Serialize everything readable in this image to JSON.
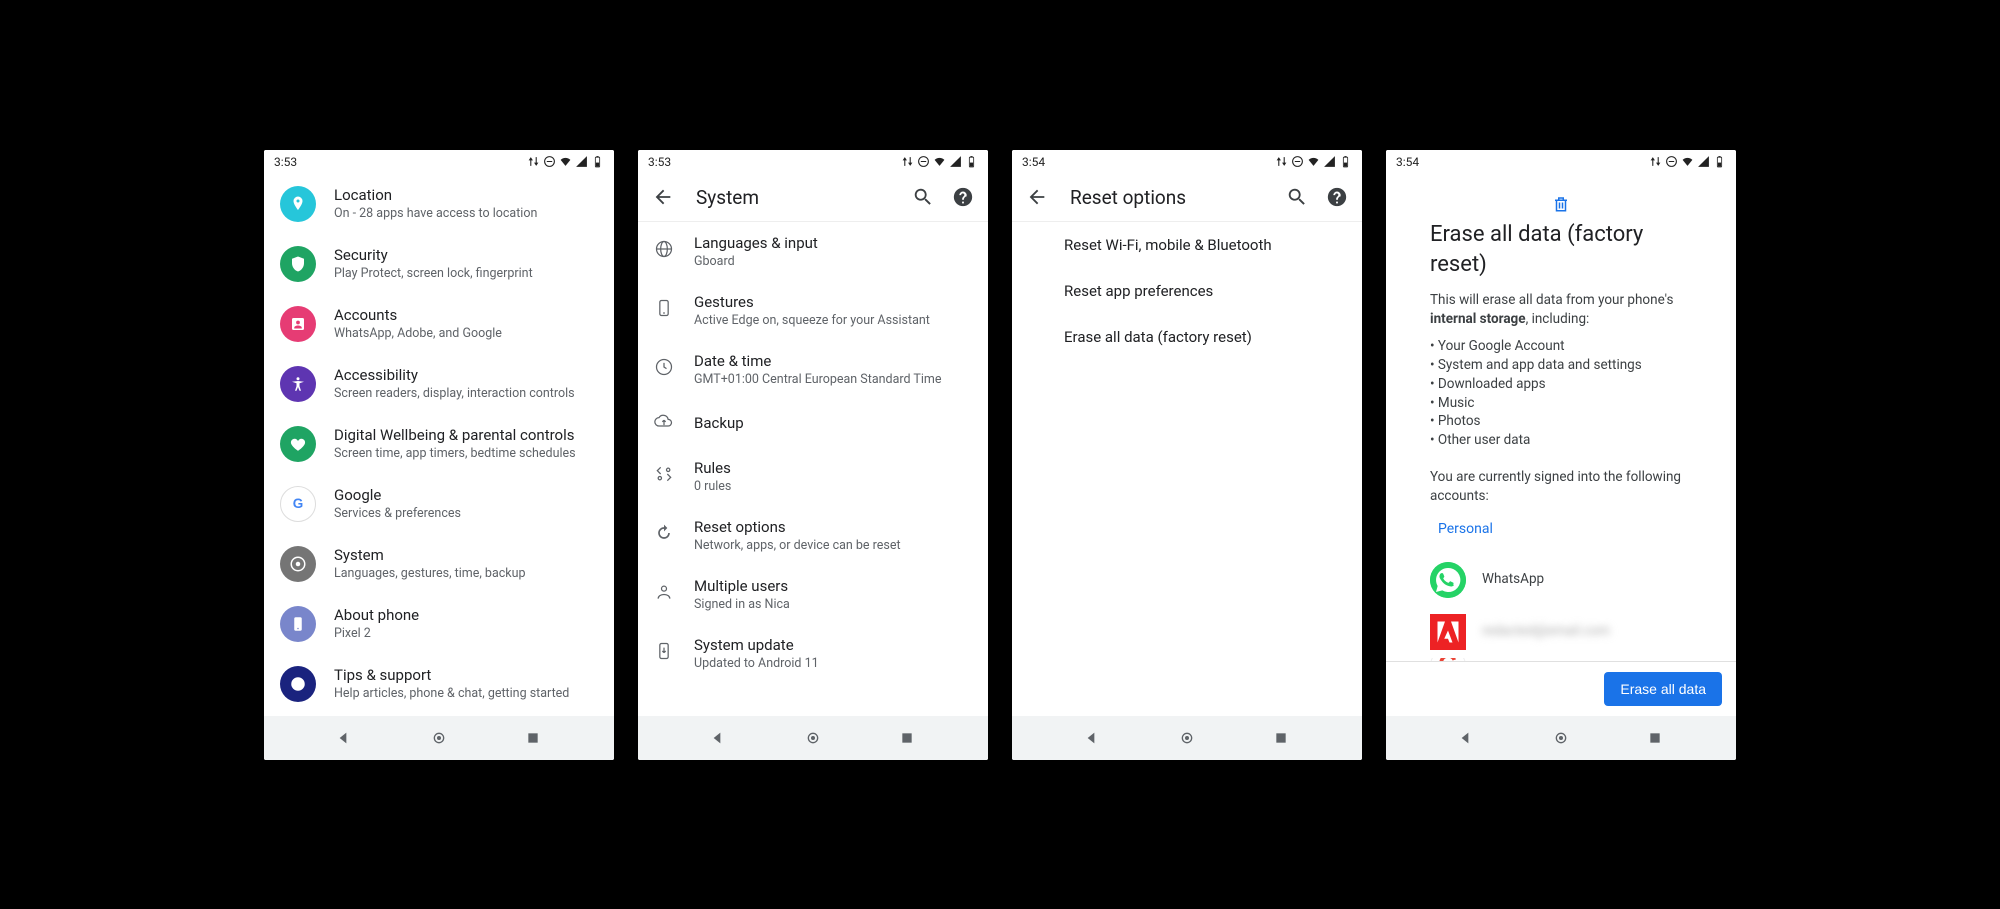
{
  "status": {
    "time1": "3:53",
    "time2": "3:53",
    "time3": "3:54",
    "time4": "3:54"
  },
  "screen1": {
    "items": [
      {
        "name": "location",
        "title": "Location",
        "sub": "On - 28 apps have access to location",
        "bg": "#26c6da"
      },
      {
        "name": "security",
        "title": "Security",
        "sub": "Play Protect, screen lock, fingerprint",
        "bg": "#1fa463"
      },
      {
        "name": "accounts",
        "title": "Accounts",
        "sub": "WhatsApp, Adobe, and Google",
        "bg": "#e63c74"
      },
      {
        "name": "accessibility",
        "title": "Accessibility",
        "sub": "Screen readers, display, interaction controls",
        "bg": "#5e35b1"
      },
      {
        "name": "wellbeing",
        "title": "Digital Wellbeing & parental controls",
        "sub": "Screen time, app timers, bedtime schedules",
        "bg": "#1fa463"
      },
      {
        "name": "google",
        "title": "Google",
        "sub": "Services & preferences",
        "bg": "#ffffff"
      },
      {
        "name": "system",
        "title": "System",
        "sub": "Languages, gestures, time, backup",
        "bg": "#757575"
      },
      {
        "name": "about",
        "title": "About phone",
        "sub": "Pixel 2",
        "bg": "#7986cb"
      },
      {
        "name": "tips",
        "title": "Tips & support",
        "sub": "Help articles, phone & chat, getting started",
        "bg": "#1a237e"
      }
    ]
  },
  "screen2": {
    "title": "System",
    "items": [
      {
        "name": "languages",
        "title": "Languages & input",
        "sub": "Gboard"
      },
      {
        "name": "gestures",
        "title": "Gestures",
        "sub": "Active Edge on, squeeze for your Assistant"
      },
      {
        "name": "datetime",
        "title": "Date & time",
        "sub": "GMT+01:00 Central European Standard Time"
      },
      {
        "name": "backup",
        "title": "Backup",
        "sub": ""
      },
      {
        "name": "rules",
        "title": "Rules",
        "sub": "0 rules"
      },
      {
        "name": "reset",
        "title": "Reset options",
        "sub": "Network, apps, or device can be reset"
      },
      {
        "name": "users",
        "title": "Multiple users",
        "sub": "Signed in as Nica"
      },
      {
        "name": "update",
        "title": "System update",
        "sub": "Updated to Android 11"
      }
    ]
  },
  "screen3": {
    "title": "Reset options",
    "items": [
      {
        "name": "reset-wifi",
        "title": "Reset Wi-Fi, mobile & Bluetooth"
      },
      {
        "name": "reset-app-prefs",
        "title": "Reset app preferences"
      },
      {
        "name": "erase-all",
        "title": "Erase all data (factory reset)"
      }
    ]
  },
  "screen4": {
    "heading": "Erase all data (factory reset)",
    "intro_pre": "This will erase all data from your phone's ",
    "intro_bold": "internal storage",
    "intro_post": ", including:",
    "bullets": [
      "Your Google Account",
      "System and app data and settings",
      "Downloaded apps",
      "Music",
      "Photos",
      "Other user data"
    ],
    "signed_in": "You are currently signed into the following accounts:",
    "personal": "Personal",
    "accounts": [
      {
        "name": "whatsapp",
        "label": "WhatsApp",
        "bg": "#25D366"
      },
      {
        "name": "adobe",
        "label": "redacted@email.com",
        "bg": "#ED2224"
      }
    ],
    "button": "Erase all data"
  }
}
